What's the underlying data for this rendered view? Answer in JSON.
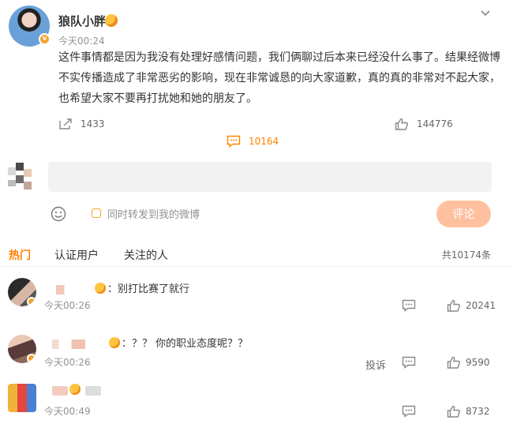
{
  "post": {
    "username": "狼队小胖",
    "time": "今天00:24",
    "text": "这件事情都是因为我没有处理好感情问题，我们俩聊过后本来已经没什么事了。结果经微博不实传播造成了非常恶劣的影响，现在非常诚恳的向大家道歉，真的真的非常对不起大家，也希望大家不要再打扰她和她的朋友了。",
    "repost_count": "1433",
    "comment_count": "10164",
    "like_count": "144776"
  },
  "compose": {
    "input_value": "",
    "repost_label": "同时转发到我的微博",
    "submit_label": "评论"
  },
  "tabs": {
    "hot": "热门",
    "verified": "认证用户",
    "following": "关注的人",
    "total": "共10174条"
  },
  "comments": [
    {
      "text": "：别打比赛了就行",
      "time": "今天00:26",
      "likes": "20241",
      "report": ""
    },
    {
      "text": "：？？ 你的职业态度呢？？",
      "time": "今天00:26",
      "likes": "9590",
      "report": "投诉"
    },
    {
      "text": "：",
      "time": "今天00:49",
      "likes": "8732",
      "report": ""
    }
  ],
  "colors": {
    "accent": "#ff8200",
    "submit_bg": "#ffc09f"
  }
}
